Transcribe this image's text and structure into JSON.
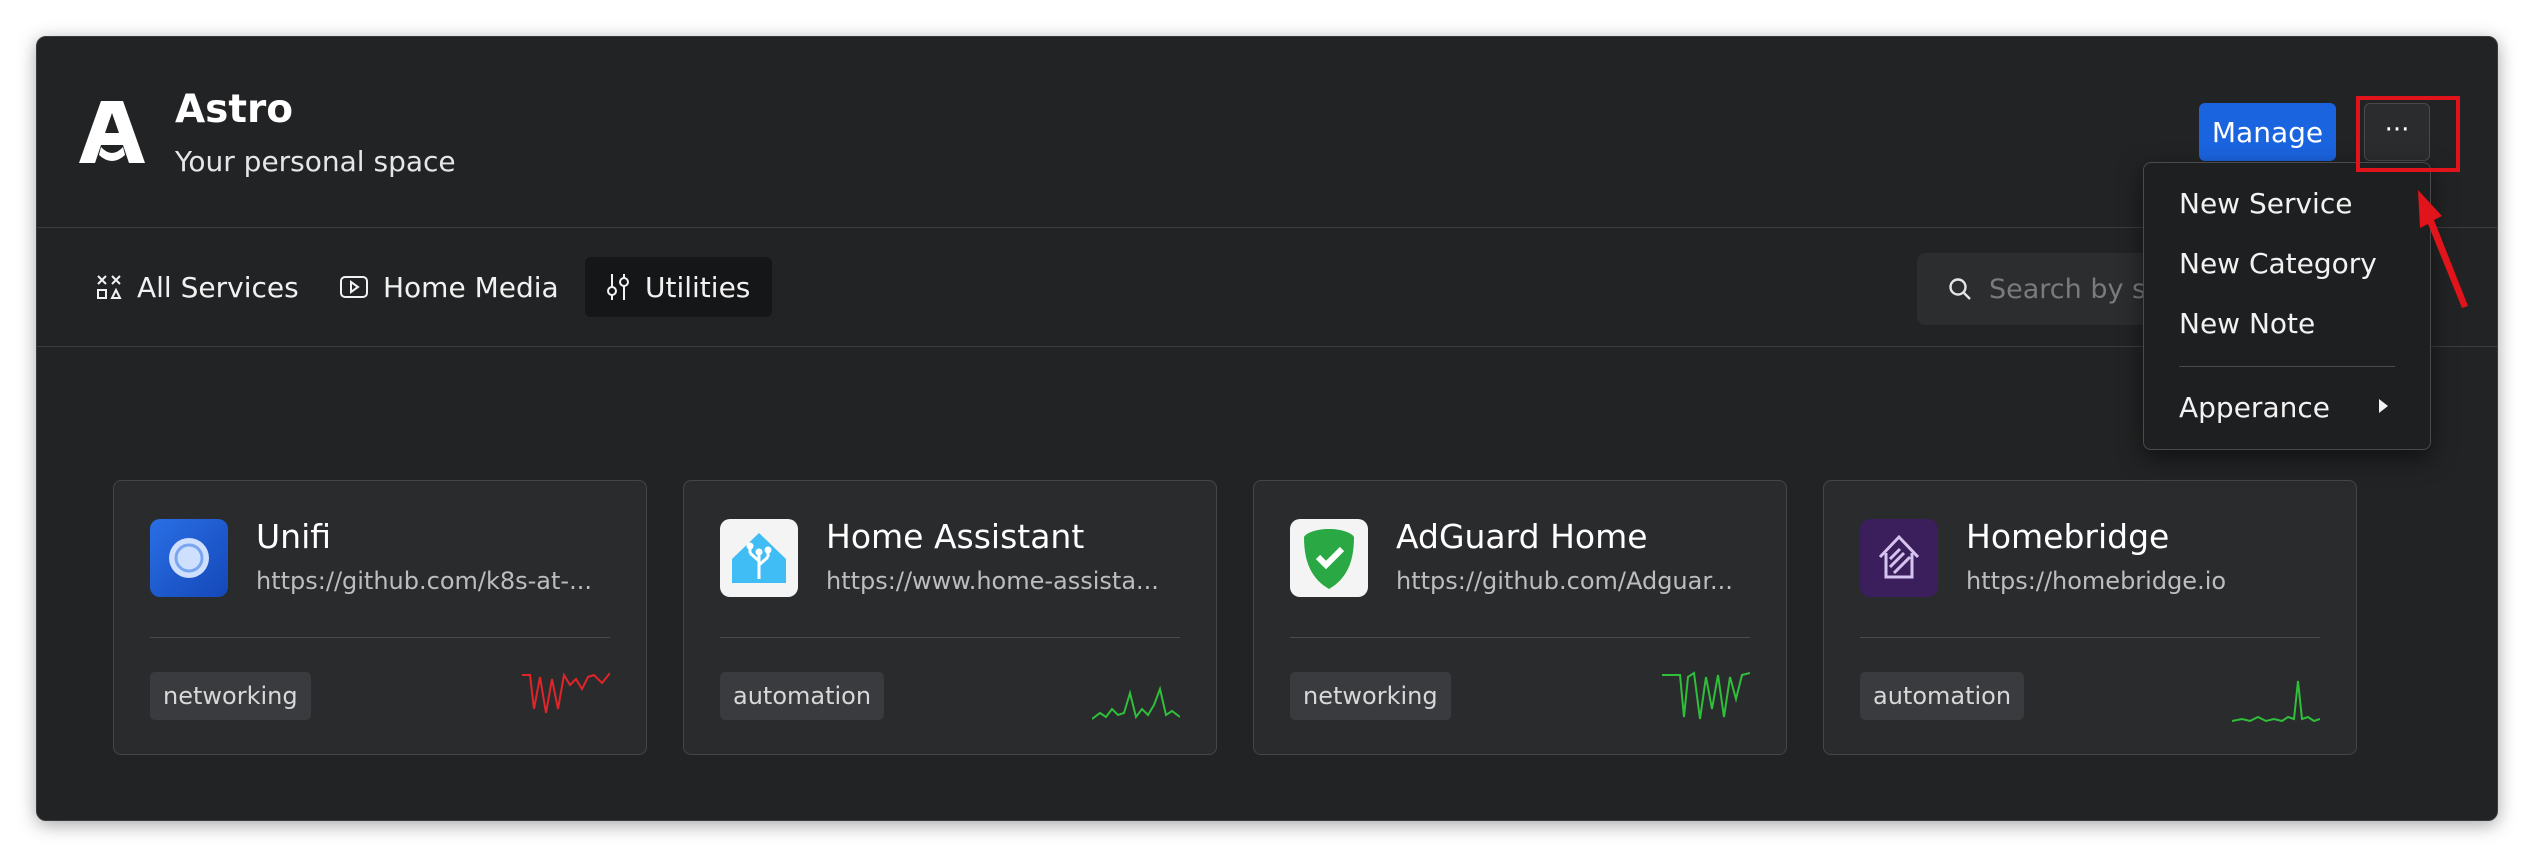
{
  "header": {
    "title": "Astro",
    "subtitle": "Your personal space",
    "manage_label": "Manage",
    "more_label": "···"
  },
  "tabs": [
    {
      "label": "All Services",
      "icon": "grid-icon"
    },
    {
      "label": "Home Media",
      "icon": "play-icon"
    },
    {
      "label": "Utilities",
      "icon": "sliders-icon",
      "active": true
    }
  ],
  "search": {
    "placeholder": "Search by se"
  },
  "cards": [
    {
      "name": "Unifi",
      "url": "https://github.com/k8s-at-...",
      "tag": "networking",
      "spark_color": "#e0252a"
    },
    {
      "name": "Home Assistant",
      "url": "https://www.home-assista...",
      "tag": "automation",
      "spark_color": "#2fbf3a"
    },
    {
      "name": "AdGuard Home",
      "url": "https://github.com/Adguar...",
      "tag": "networking",
      "spark_color": "#2fbf3a"
    },
    {
      "name": "Homebridge",
      "url": "https://homebridge.io",
      "tag": "automation",
      "spark_color": "#2fbf3a"
    }
  ],
  "menu": {
    "items": [
      "New Service",
      "New Category",
      "New Note"
    ],
    "appearance_label": "Apperance"
  },
  "colors": {
    "accent": "#1b64e0",
    "highlight": "#e0141a"
  }
}
